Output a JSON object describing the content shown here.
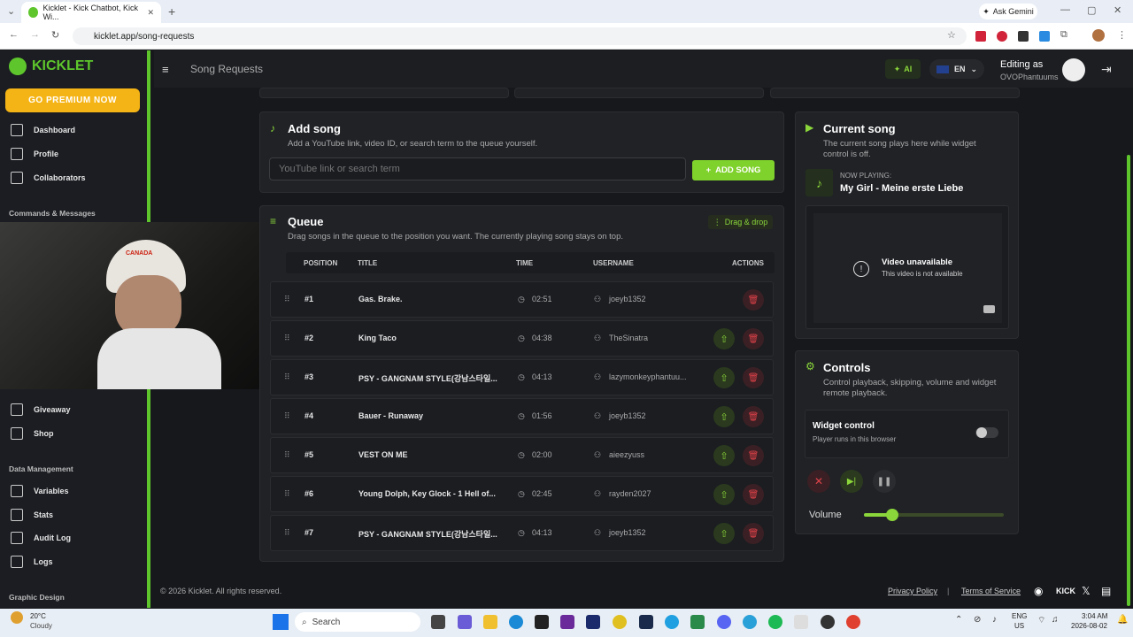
{
  "browser": {
    "tab_title": "Kicklet - Kick Chatbot, Kick Wi...",
    "url": "kicklet.app/song-requests",
    "gemini": "Ask Gemini"
  },
  "sidebar": {
    "logo": "KICKLET",
    "premium": "GO PREMIUM NOW",
    "items_top": [
      "Dashboard",
      "Profile",
      "Collaborators"
    ],
    "section_cm": "Commands & Messages",
    "items_mid": [
      "Giveaway",
      "Shop"
    ],
    "section_dm": "Data Management",
    "items_dm": [
      "Variables",
      "Stats",
      "Audit Log",
      "Logs"
    ],
    "section_gd": "Graphic Design"
  },
  "topbar": {
    "title": "Song Requests",
    "ai": "AI",
    "lang": "EN",
    "editing_as": "Editing as",
    "user": "OVOPhantuums"
  },
  "add_song": {
    "title": "Add song",
    "desc": "Add a YouTube link, video ID, or search term to the queue yourself.",
    "placeholder": "YouTube link or search term",
    "button": "ADD SONG"
  },
  "queue": {
    "title": "Queue",
    "desc": "Drag songs in the queue to the position you want. The currently playing song stays on top.",
    "badge": "Drag & drop",
    "headers": [
      "POSITION",
      "TITLE",
      "TIME",
      "USERNAME",
      "ACTIONS"
    ],
    "rows": [
      {
        "pos": "#1",
        "title": "Gas. Brake.",
        "time": "02:51",
        "user": "joeyb1352"
      },
      {
        "pos": "#2",
        "title": "King Taco",
        "time": "04:38",
        "user": "TheSinatra"
      },
      {
        "pos": "#3",
        "title": "PSY - GANGNAM STYLE(강남스타일...",
        "time": "04:13",
        "user": "lazymonkeyphantuu..."
      },
      {
        "pos": "#4",
        "title": "Bauer - Runaway",
        "time": "01:56",
        "user": "joeyb1352"
      },
      {
        "pos": "#5",
        "title": "VEST ON ME",
        "time": "02:00",
        "user": "aieezyuss"
      },
      {
        "pos": "#6",
        "title": "Young Dolph, Key Glock - 1 Hell of...",
        "time": "02:45",
        "user": "rayden2027"
      },
      {
        "pos": "#7",
        "title": "PSY - GANGNAM STYLE(강남스타일...",
        "time": "04:13",
        "user": "joeyb1352"
      }
    ]
  },
  "current": {
    "title": "Current song",
    "desc": "The current song plays here while widget control is off.",
    "now_label": "NOW PLAYING:",
    "now_title": "My Girl - Meine erste Liebe",
    "video_title": "Video unavailable",
    "video_sub": "This video is not available"
  },
  "controls": {
    "title": "Controls",
    "desc": "Control playback, skipping, volume and widget remote playback.",
    "widget_title": "Widget control",
    "widget_sub": "Player runs in this browser",
    "volume": "Volume",
    "volume_level": 0.2
  },
  "footer": {
    "copy": "© 2026 Kicklet. All rights reserved.",
    "privacy": "Privacy Policy",
    "sep": "|",
    "terms": "Terms of Service",
    "kick": "KICK"
  },
  "taskbar": {
    "temp": "20°C",
    "weather": "Cloudy",
    "search": "Search",
    "lang1": "ENG",
    "lang2": "US",
    "time": "3:04 AM",
    "date": "2026-08-02"
  },
  "webcam": {
    "cap_text": "CANADA"
  }
}
